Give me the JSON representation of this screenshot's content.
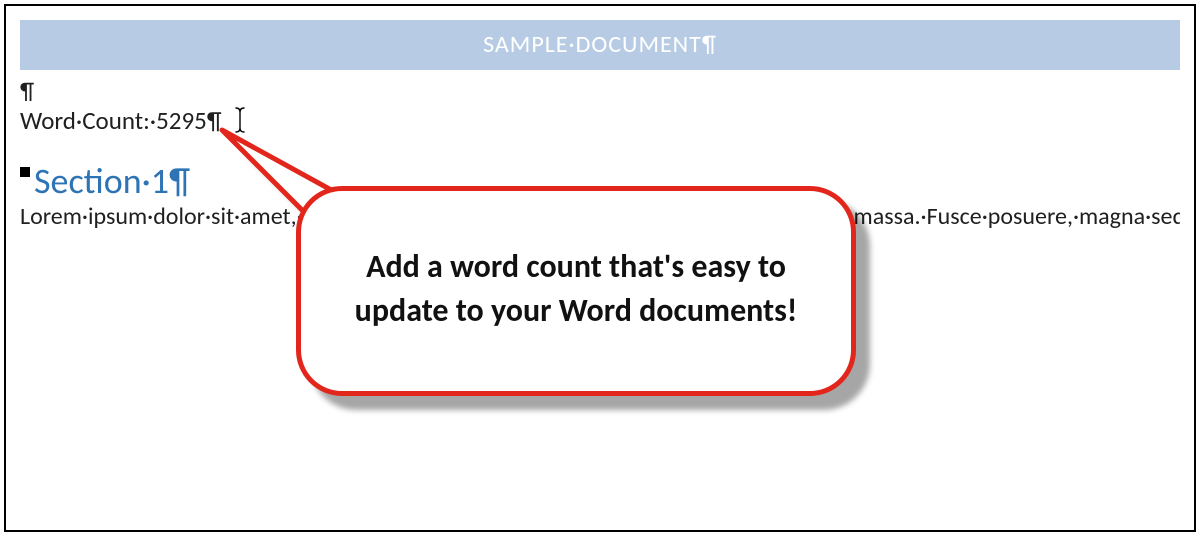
{
  "colors": {
    "title_bg": "#b7cce4",
    "title_fg": "#ffffff",
    "heading_fg": "#2e74b5",
    "callout_border": "#e3261c",
    "body_fg": "#202020"
  },
  "formatting_marks": {
    "pilcrow": "¶",
    "middle_dot": "·"
  },
  "title": "SAMPLE·DOCUMENT¶",
  "blank_paragraph": "¶",
  "word_count": {
    "label": "Word·Count:·",
    "value": "5295",
    "trailing": "¶"
  },
  "section": {
    "heading": "Section·1¶",
    "body": "Lorem·ipsum·dolor·sit·amet,·consectetuer·adipiscing·elit.·Maecenas·porttitor·congue·massa.·Fusce·posuere,·magna·sed·pulvinar·ultricies,·purus·lectus·malesuada·libero,·sit·amet·commodo·magna·eros·quis·urna.·Nunc·viverra·imperdiet·enim.·Fusce·est.·Vivamus·a·tellus.·Pellentesque·habitant·morbi·tristique·senectus·et·netus·et·malesuada·fames·ac·turpis·egestas.·Proin·pharetra·nonummy·pede.·Mauris·et·orci.·Aenean·nec·lorem.·In·porttitor.·Donec·laoreet·nonummy·augue.·Suspendisse·dui·purus,·scelerisque·at,·vulputate·vitae,·pretium·mattis,·nunc.·Mauris·eget·neque·at·sem·venenatis·eleifend.·Ut·nonummy.·Fusce·aliquet·pede·non·pede.·Suspendisse·dapibus·lorem·pellentesque·magna.·Integer·nulla.·Donec·blandit·feugiat·ligula.·Donec·hendrerit,·felis·et·imperdiet·euismod,·purus·ipsum·pretium·metus,·in·lacinia·nulla·nisl·eget·sapien.¶"
  },
  "callout": {
    "text": "Add a word count that's easy to update to your Word documents!"
  }
}
